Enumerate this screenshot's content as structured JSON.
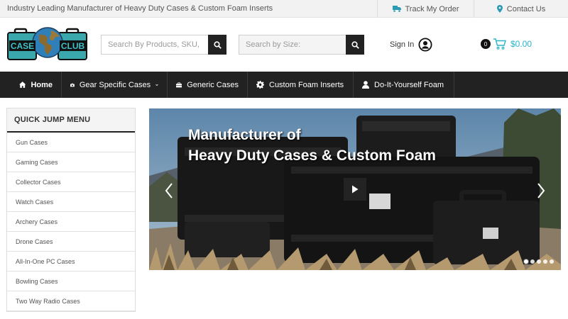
{
  "topbar": {
    "tagline": "Industry Leading Manufacturer of Heavy Duty Cases & Custom Foam Inserts",
    "track_order": "Track My Order",
    "contact_us": "Contact Us"
  },
  "header": {
    "logo": {
      "word1": "CASE",
      "word2": "CLUB"
    },
    "search_products": {
      "placeholder": "Search By Products, SKU, I"
    },
    "search_size": {
      "placeholder": "Search by Size:"
    },
    "sign_in": "Sign In",
    "cart": {
      "count": "0",
      "total": "$0.00"
    }
  },
  "nav": {
    "items": [
      {
        "label": "Home",
        "icon": "home-icon"
      },
      {
        "label": "Gear Specific Cases",
        "icon": "camera-icon"
      },
      {
        "label": "Generic Cases",
        "icon": "briefcase-icon"
      },
      {
        "label": "Custom Foam Inserts",
        "icon": "gear-icon"
      },
      {
        "label": "Do-It-Yourself Foam",
        "icon": "user-icon"
      }
    ]
  },
  "sidebar": {
    "title": "QUICK JUMP MENU",
    "items": [
      {
        "label": "Gun Cases"
      },
      {
        "label": "Gaming Cases"
      },
      {
        "label": "Collector Cases"
      },
      {
        "label": "Watch Cases"
      },
      {
        "label": "Archery Cases"
      },
      {
        "label": "Drone Cases"
      },
      {
        "label": "All-In-One PC Cases"
      },
      {
        "label": "Bowling Cases"
      },
      {
        "label": "Two Way Radio Cases"
      }
    ]
  },
  "hero": {
    "line1": "Manufacturer of",
    "line2": "Heavy Duty Cases & Custom Foam",
    "dots": 5,
    "active_dot": 0
  },
  "colors": {
    "accent": "#26b5c9",
    "nav_bg": "#222222",
    "topbar_bg": "#f2f2f2"
  }
}
